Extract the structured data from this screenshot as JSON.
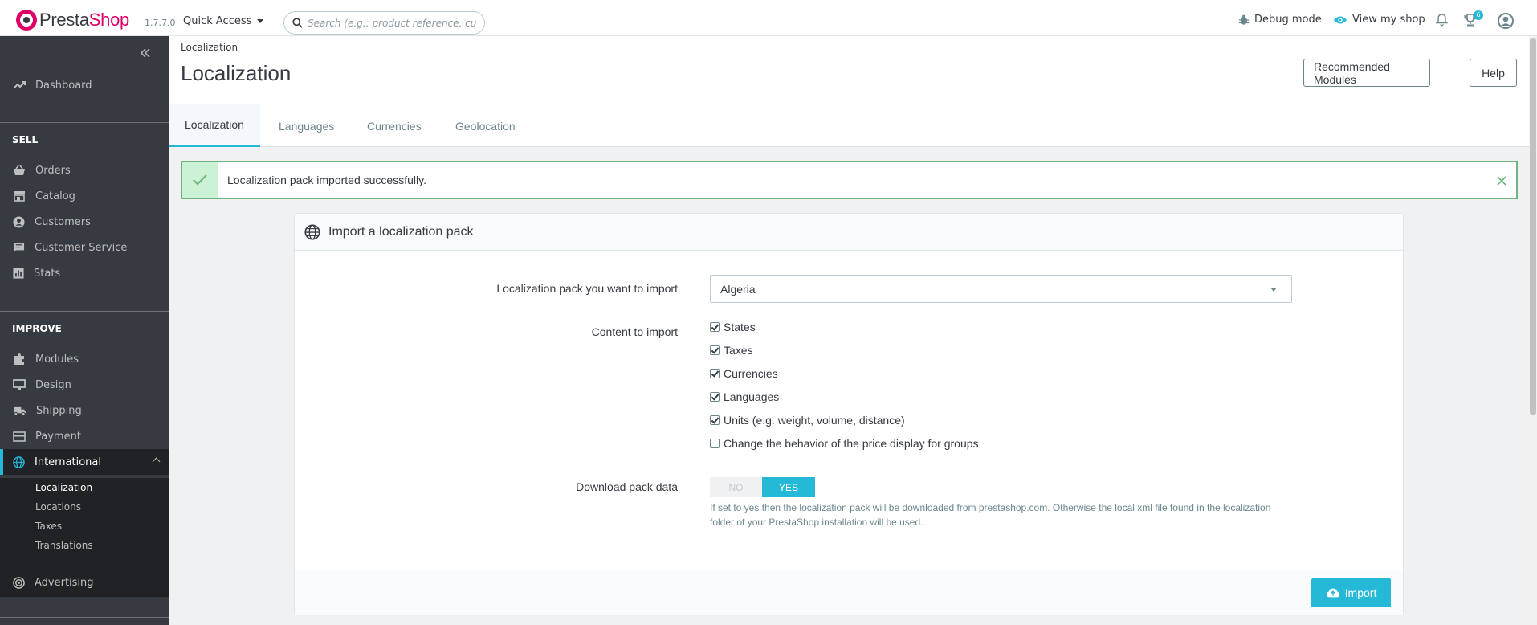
{
  "header": {
    "logo_text_1": "Presta",
    "logo_text_2": "Shop",
    "version": "1.7.7.0",
    "quick_access": "Quick Access",
    "search_placeholder": "Search (e.g.: product reference, custome",
    "debug_mode": "Debug mode",
    "view_shop": "View my shop",
    "notif_count": "6"
  },
  "sidebar": {
    "dashboard": "Dashboard",
    "sell_title": "SELL",
    "sell_items": [
      "Orders",
      "Catalog",
      "Customers",
      "Customer Service",
      "Stats"
    ],
    "improve_title": "IMPROVE",
    "improve_items": [
      "Modules",
      "Design",
      "Shipping",
      "Payment"
    ],
    "international": "International",
    "sub_items": [
      "Localization",
      "Locations",
      "Taxes",
      "Translations"
    ],
    "advertising": "Advertising"
  },
  "page": {
    "breadcrumb": "Localization",
    "title": "Localization",
    "recommended_modules": "Recommended Modules",
    "help": "Help",
    "tabs": [
      "Localization",
      "Languages",
      "Currencies",
      "Geolocation"
    ]
  },
  "alert": {
    "message": "Localization pack imported successfully."
  },
  "panel": {
    "title": "Import a localization pack",
    "pack_label": "Localization pack you want to import",
    "pack_value": "Algeria",
    "content_label": "Content to import",
    "content_options": [
      {
        "label": "States",
        "checked": true
      },
      {
        "label": "Taxes",
        "checked": true
      },
      {
        "label": "Currencies",
        "checked": true
      },
      {
        "label": "Languages",
        "checked": true
      },
      {
        "label": "Units (e.g. weight, volume, distance)",
        "checked": true
      },
      {
        "label": "Change the behavior of the price display for groups",
        "checked": false
      }
    ],
    "download_label": "Download pack data",
    "switch_no": "NO",
    "switch_yes": "YES",
    "help_text": "If set to yes then the localization pack will be downloaded from prestashop.com. Otherwise the local xml file found in the localization folder of your PrestaShop installation will be used.",
    "import_button": "Import"
  },
  "colors": {
    "accent": "#25b9d7",
    "brand_pink": "#df0067",
    "sidebar_bg": "#363a41",
    "success": "#70b580"
  }
}
